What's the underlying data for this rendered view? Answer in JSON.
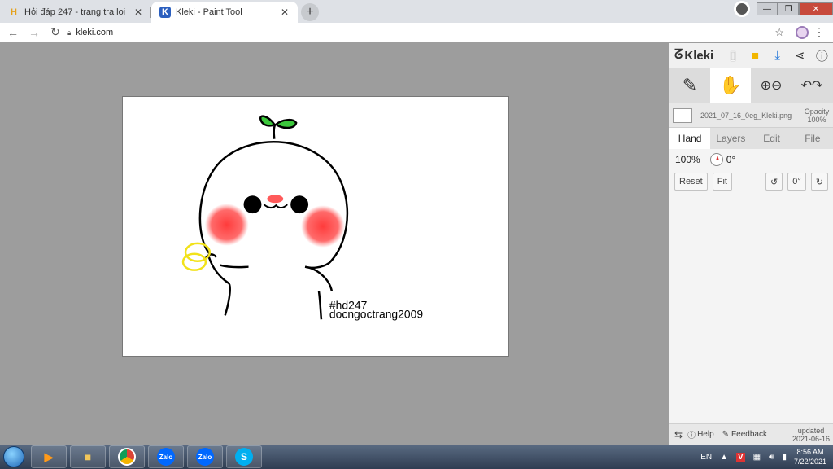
{
  "browser": {
    "tabs": [
      {
        "title": "Hỏi đáp 247 - trang tra loi",
        "favicon": "H",
        "favicon_color": "#e5a11b"
      },
      {
        "title": "Kleki - Paint Tool",
        "favicon": "K",
        "favicon_color": "#2b5fbf"
      }
    ],
    "new_tab_label": "+",
    "url": "kleki.com",
    "window_controls": {
      "minimize": "—",
      "maximize": "❐",
      "close": "✕"
    }
  },
  "canvas": {
    "signature_line1": "#hd247",
    "signature_line2": "docngoctrang2009"
  },
  "panel": {
    "brand": "Kleki",
    "file_name": "2021_07_16_0eg_Kleki.png",
    "opacity_label": "Opacity",
    "opacity_value": "100%",
    "tabs": [
      "Hand",
      "Layers",
      "Edit",
      "File"
    ],
    "active_tab": "Hand",
    "zoom": "100%",
    "angle": "0°",
    "buttons": {
      "reset": "Reset",
      "fit": "Fit",
      "angle_btn": "0°"
    },
    "help": "Help",
    "feedback": "Feedback",
    "updated_label": "updated",
    "updated_date": "2021-06-16"
  },
  "taskbar": {
    "apps": [
      "Zalo",
      "Zalo"
    ],
    "language": "EN",
    "time": "8:56 AM",
    "date": "7/22/2021"
  },
  "colors": {
    "accent": "#2b5fbf",
    "blush": "#ff4d4d",
    "leaf": "#3cc83c",
    "halo": "#f2e21a"
  }
}
